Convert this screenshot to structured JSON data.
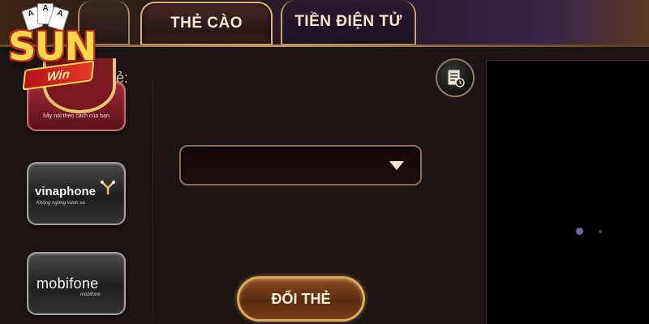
{
  "logo": {
    "main_text": "SUN",
    "sub_text": "Win",
    "cards": [
      "A",
      "A",
      "A"
    ]
  },
  "tabs": {
    "active_label": "THẺ CÀO",
    "crypto_label": "TIỀN ĐIỆN TỬ"
  },
  "left_panel": {
    "label": "Thẻ:",
    "carriers": [
      {
        "name": "",
        "tagline": "hãy nói theo cách của bạn"
      },
      {
        "name": "vinaphone",
        "tagline": "Không ngừng vươn xa"
      },
      {
        "name": "mobifone",
        "tagline": "mobifone"
      }
    ]
  },
  "form": {
    "select_value": "",
    "submit_label": "ĐỔI THẺ"
  },
  "icons": {
    "history": "history-list-icon",
    "dropdown": "chevron-down-icon"
  },
  "colors": {
    "accent_gold": "#d8aa5a",
    "background": "#1c1515",
    "preview_bg": "#000000"
  }
}
